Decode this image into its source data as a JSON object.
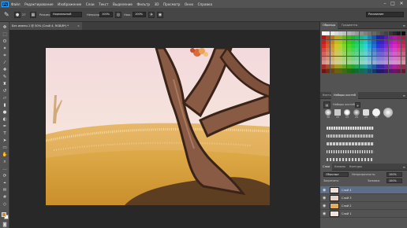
{
  "menubar": {
    "logo": "Ps",
    "items": [
      "Файл",
      "Редактирование",
      "Изображение",
      "Слои",
      "Текст",
      "Выделение",
      "Фильтр",
      "3D",
      "Просмотр",
      "Окно",
      "Справка"
    ],
    "window_buttons": [
      "–",
      "□",
      "✕"
    ]
  },
  "options": {
    "brush_size": "27",
    "mode_label": "Режим:",
    "mode_value": "Нормальный",
    "opacity_label": "Непрозр.:",
    "opacity_value": "100%",
    "flow_label": "Наж.:",
    "flow_value": "100%",
    "workspace": "Рисование"
  },
  "document": {
    "tab_title": "Без имени-1 @ 50% (Слой 4, RGB/8*) *",
    "close": "×"
  },
  "colors": {
    "foreground": "#c88a3a",
    "background": "#ffffff"
  },
  "panels": {
    "swatches_tabs": [
      "Образцы",
      "Градиенты"
    ],
    "brush_tabs": [
      "Кисть",
      "Наборы кистей"
    ],
    "brush_label": "Наборы кистей",
    "brush_sizes": [
      "30",
      "25",
      "25",
      "25",
      "25",
      "50",
      "60"
    ],
    "layers_tabs": [
      "Слои",
      "Каналы",
      "Контуры"
    ],
    "blend_mode": "Обычные",
    "opacity_label": "Непрозрачность:",
    "opacity_value": "100%",
    "lock_label": "Закрепить:",
    "fill_label": "Заливка:",
    "fill_value": "100%",
    "layers": [
      {
        "name": "Слой 4",
        "active": true
      },
      {
        "name": "Слой 3",
        "active": false
      },
      {
        "name": "Слой 2",
        "active": false
      },
      {
        "name": "Слой 1",
        "active": false
      }
    ]
  }
}
